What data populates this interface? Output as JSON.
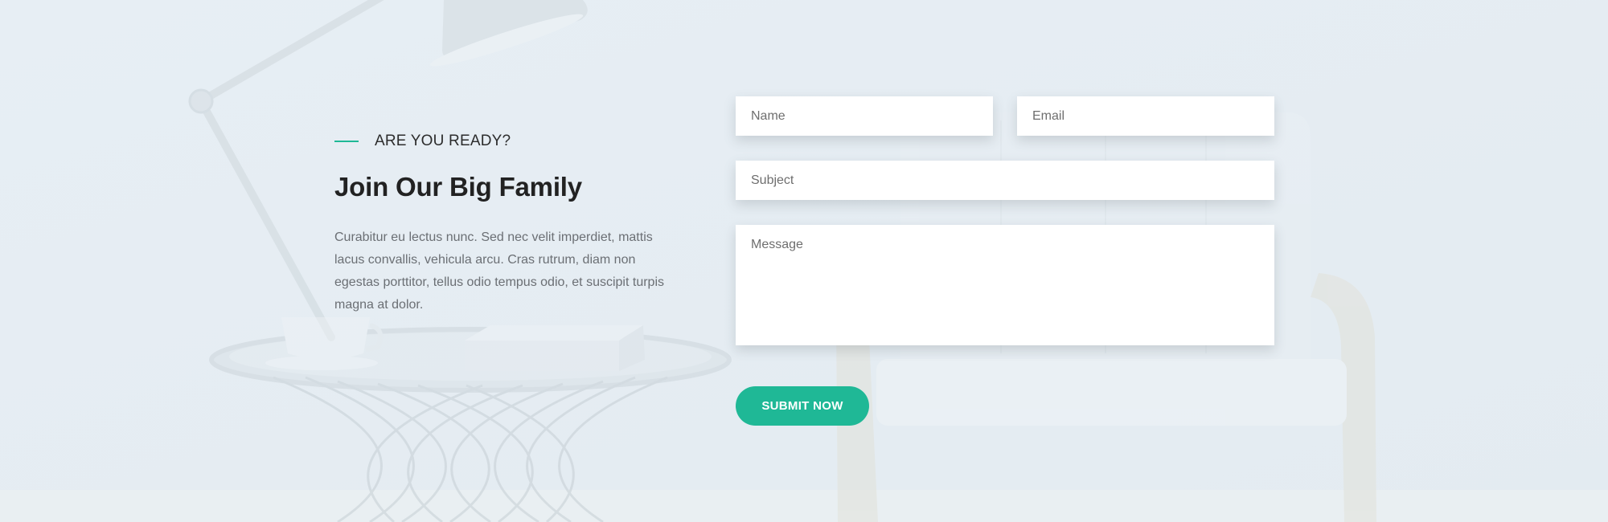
{
  "section": {
    "eyebrow": "ARE YOU READY?",
    "title": "Join Our Big Family",
    "description": "Curabitur eu lectus nunc. Sed nec velit imperdiet, mattis lacus convallis, vehicula arcu. Cras rutrum, diam non egestas porttitor, tellus odio tempus odio, et suscipit turpis magna at dolor."
  },
  "form": {
    "name_placeholder": "Name",
    "email_placeholder": "Email",
    "subject_placeholder": "Subject",
    "message_placeholder": "Message",
    "submit_label": "SUBMIT NOW"
  },
  "colors": {
    "accent": "#1fb896",
    "background": "#e6edf2",
    "heading": "#222222",
    "body_text": "#6b6f74"
  },
  "background_image": {
    "subject": "faded interior with desk lamp, round wire side table with cup and book, and armchair"
  }
}
